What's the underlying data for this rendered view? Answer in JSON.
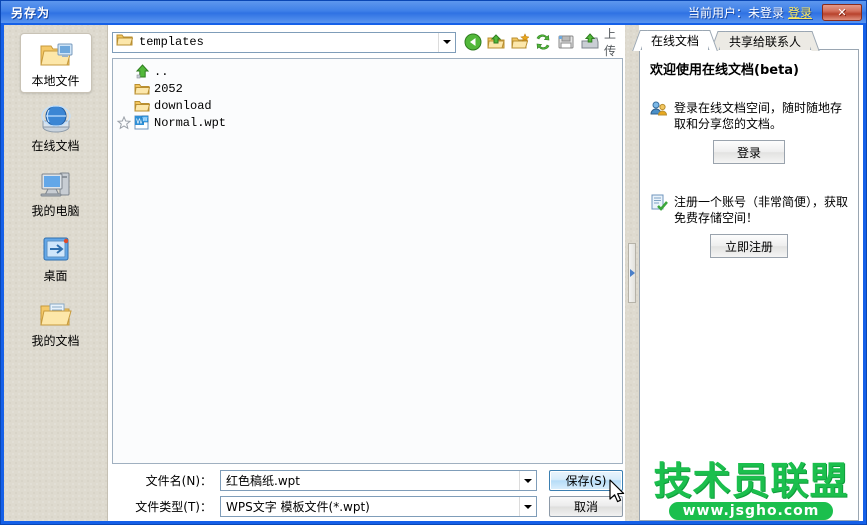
{
  "window": {
    "title": "另存为",
    "current_user_label": "当前用户：未登录",
    "login_link": "登录",
    "close_label": "✕"
  },
  "sidebar": {
    "items": [
      {
        "label": "本地文件",
        "icon": "local-files-icon",
        "selected": true
      },
      {
        "label": "在线文档",
        "icon": "online-docs-icon",
        "selected": false
      },
      {
        "label": "我的电脑",
        "icon": "my-computer-icon",
        "selected": false
      },
      {
        "label": "桌面",
        "icon": "desktop-icon",
        "selected": false
      },
      {
        "label": "我的文档",
        "icon": "my-documents-icon",
        "selected": false
      }
    ]
  },
  "toolbar": {
    "path_value": "templates",
    "path_icon": "folder-icon",
    "buttons": [
      {
        "name": "back-button",
        "icon": "back-arrow-icon"
      },
      {
        "name": "up-folder-button",
        "icon": "up-folder-icon"
      },
      {
        "name": "new-folder-button",
        "icon": "new-folder-icon"
      },
      {
        "name": "refresh-button",
        "icon": "refresh-icon"
      },
      {
        "name": "view-button",
        "icon": "save-view-icon"
      },
      {
        "name": "upload-button",
        "icon": "upload-icon"
      }
    ],
    "upload_label": "上传"
  },
  "filelist": {
    "rows": [
      {
        "name": "..",
        "icon": "up-directory-icon",
        "starred": false
      },
      {
        "name": "2052",
        "icon": "folder-icon",
        "starred": false
      },
      {
        "name": "download",
        "icon": "folder-icon",
        "starred": false
      },
      {
        "name": "Normal.wpt",
        "icon": "wps-document-icon",
        "starred": true
      }
    ]
  },
  "form": {
    "filename_label": "文件名(N)：",
    "filename_value": "红色稿纸.wpt",
    "filetype_label": "文件类型(T)：",
    "filetype_value": "WPS文字  模板文件(*.wpt)",
    "save_button": "保存(S)",
    "cancel_button": "取消"
  },
  "rightpanel": {
    "tabs": [
      {
        "label": "在线文档",
        "active": true
      },
      {
        "label": "共享给联系人",
        "active": false
      }
    ],
    "heading": "欢迎使用在线文档(beta)",
    "promos": [
      {
        "icon": "users-login-icon",
        "text": "登录在线文档空间，随时随地存取和分享您的文档。",
        "button": "登录"
      },
      {
        "icon": "register-check-icon",
        "text": "注册一个账号（非常简便），获取免费存储空间！",
        "button": "立即注册"
      }
    ]
  },
  "watermark": {
    "main": "技术员联盟",
    "url": "www.jsgho.com"
  },
  "colors": {
    "title_blue": "#3f80e8",
    "window_border": "#1560e8",
    "link_yellow": "#ffe95c",
    "sidebar_bg": "#dedacf",
    "watermark_green": "#1bbf4d",
    "close_red": "#b8422c"
  }
}
